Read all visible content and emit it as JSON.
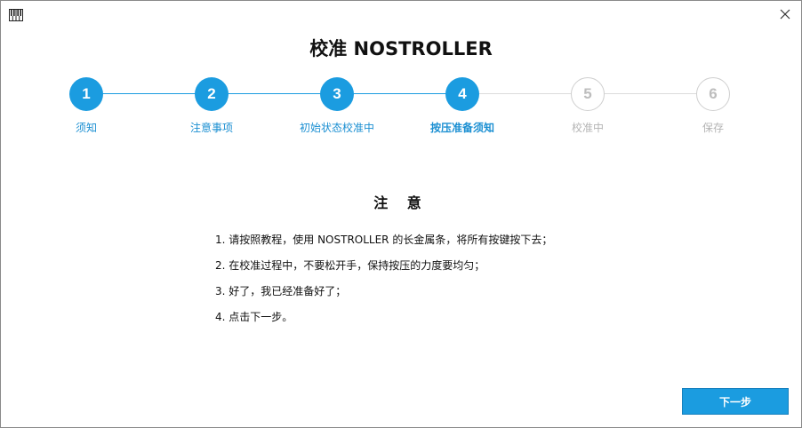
{
  "window": {
    "app_icon": "piano-keyboard-icon",
    "close_icon": "close-icon"
  },
  "title": "校准 NOSTROLLER",
  "steps": [
    {
      "number": "1",
      "label": "须知",
      "state": "done"
    },
    {
      "number": "2",
      "label": "注意事项",
      "state": "done"
    },
    {
      "number": "3",
      "label": "初始状态校准中",
      "state": "done"
    },
    {
      "number": "4",
      "label": "按压准备须知",
      "state": "current"
    },
    {
      "number": "5",
      "label": "校准中",
      "state": "todo"
    },
    {
      "number": "6",
      "label": "保存",
      "state": "todo"
    }
  ],
  "notice": {
    "title": "注 意",
    "items": [
      "1. 请按照教程，使用 NOSTROLLER 的长金属条，将所有按键按下去；",
      "2. 在校准过程中，不要松开手，保持按压的力度要均匀；",
      "3. 好了，我已经准备好了；",
      "4. 点击下一步。"
    ]
  },
  "buttons": {
    "next_label": "下一步"
  },
  "colors": {
    "accent": "#1b9ce0",
    "inactive": "#cfcfcf",
    "inactive_text": "#b4b4b4"
  }
}
